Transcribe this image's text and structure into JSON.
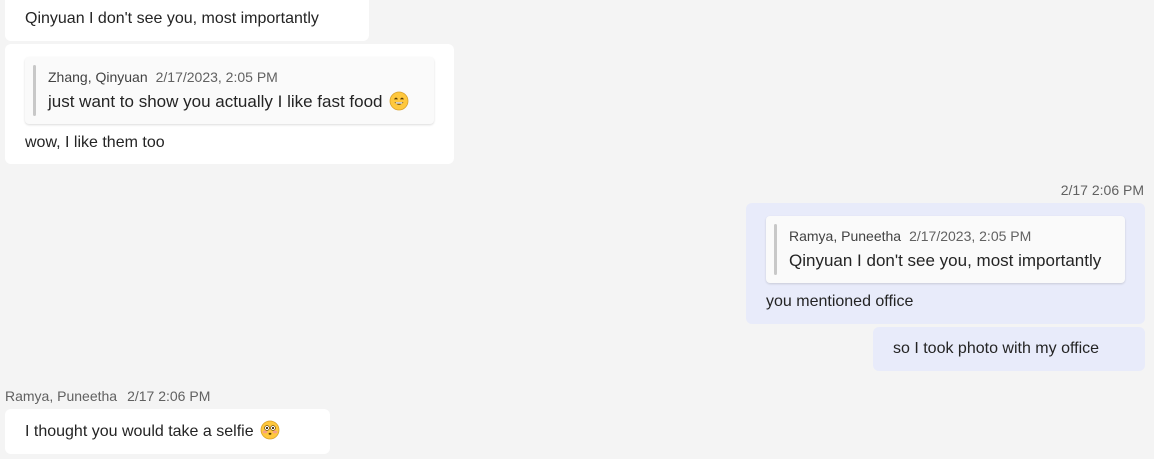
{
  "messages": {
    "m1": {
      "text": "Qinyuan I don't see you, most importantly"
    },
    "m2": {
      "quote": {
        "author": "Zhang, Qinyuan",
        "timestamp": "2/17/2023, 2:05 PM",
        "text": "just want to show you actually I like fast food",
        "emoji": "grinning-face-icon"
      },
      "text": "wow, I like them too"
    },
    "m3": {
      "timestamp": "2/17 2:06 PM",
      "quote": {
        "author": "Ramya, Puneetha",
        "timestamp": "2/17/2023, 2:05 PM",
        "text": "Qinyuan I don't see you, most importantly"
      },
      "text": "you mentioned office"
    },
    "m4": {
      "text": "so I took photo with my office"
    },
    "m5": {
      "author": "Ramya, Puneetha",
      "timestamp": "2/17 2:06 PM",
      "text": "I thought you would take a selfie",
      "emoji": "flushed-face-icon"
    }
  },
  "colors": {
    "background": "#f4f4f4",
    "incoming_bubble": "#ffffff",
    "outgoing_bubble": "#e8ebfa",
    "quote_bar": "#c8c8c8"
  }
}
